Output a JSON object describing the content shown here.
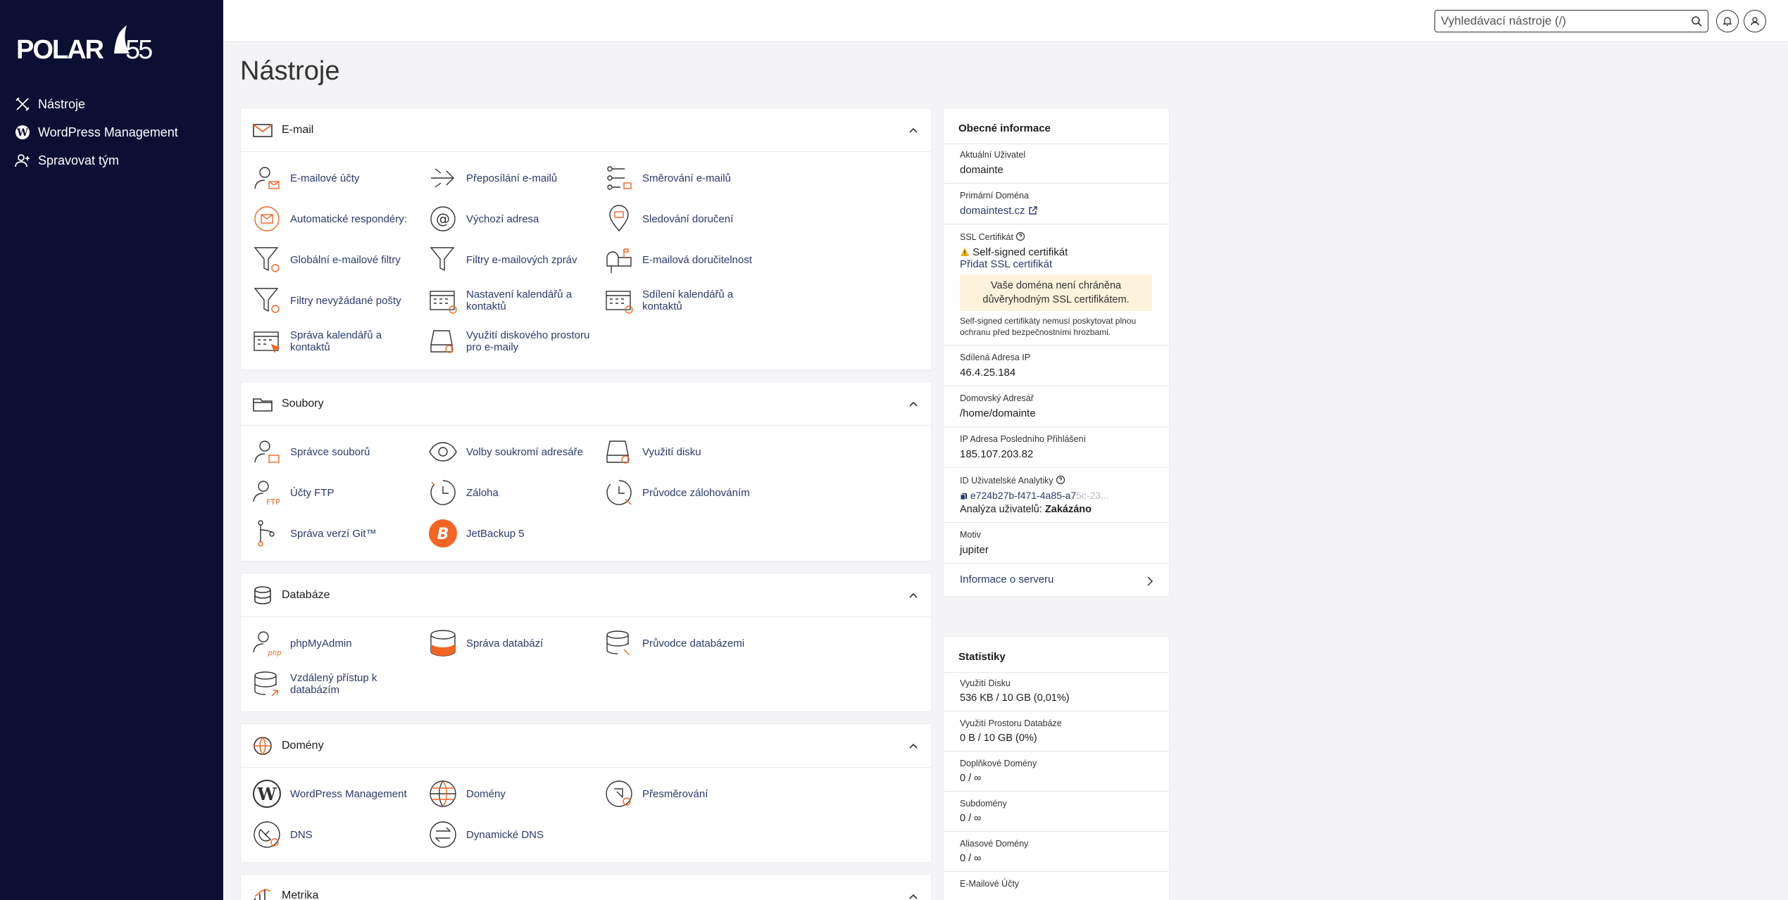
{
  "logo": {
    "text": "POLAR",
    "number": "55"
  },
  "sidebar": {
    "items": [
      {
        "label": "Nástroje",
        "icon": "tools-icon"
      },
      {
        "label": "WordPress Management",
        "icon": "wordpress-icon"
      },
      {
        "label": "Spravovat tým",
        "icon": "user-plus-icon"
      }
    ]
  },
  "topbar": {
    "search_placeholder": "Vyhledávací nástroje (/)"
  },
  "page_title": "Nástroje",
  "sections": [
    {
      "title": "E-mail",
      "items": [
        "E-mailové účty",
        "Přeposílání e-mailů",
        "Směrování e-mailů",
        "Automatické respondéry:",
        "Výchozí adresa",
        "Sledování doručení",
        "Globální e-mailové filtry",
        "Filtry e-mailových zpráv",
        "E-mailová doručitelnost",
        "Filtry nevyžádané pošty",
        "Nastavení kalendářů a kontaktů",
        "Sdílení kalendářů a kontaktů",
        "Správa kalendářů a kontaktů",
        "Využití diskového prostoru pro e-maily"
      ]
    },
    {
      "title": "Soubory",
      "items": [
        "Správce souborů",
        "Volby soukromí adresáře",
        "Využití disku",
        "Účty FTP",
        "Záloha",
        "Průvodce zálohováním",
        "Správa verzí Git™",
        "JetBackup 5"
      ]
    },
    {
      "title": "Databáze",
      "items": [
        "phpMyAdmin",
        "Správa databází",
        "Průvodce databázemi",
        "Vzdálený přístup k databázím"
      ]
    },
    {
      "title": "Domény",
      "items": [
        "WordPress Management",
        "Domény",
        "Přesměrování",
        "DNS",
        "Dynamické DNS"
      ]
    },
    {
      "title": "Metrika",
      "items": []
    }
  ],
  "info": {
    "title": "Obecné informace",
    "current_user_label": "Aktuální Uživatel",
    "current_user": "domainte",
    "primary_domain_label": "Primární Doména",
    "primary_domain": "domaintest.cz",
    "ssl_label": "SSL Certifikát",
    "ssl_status": "Self-signed certifikát",
    "ssl_add": "Přidat SSL certifikát",
    "ssl_warning": "Vaše doména není chráněna důvěryhodným SSL certifikátem.",
    "ssl_note": "Self-signed certifikáty nemusí poskytovat plnou ochranu před bezpečnostními hrozbami.",
    "shared_ip_label": "Sdílená Adresa IP",
    "shared_ip": "46.4.25.184",
    "home_label": "Domovský Adresář",
    "home": "/home/domainte",
    "last_ip_label": "IP Adresa Posledního Přihlášení",
    "last_ip": "185.107.203.82",
    "analytics_label": "ID Uživatelské Analytiky",
    "analytics_id": "e724b27b-f471-4a85-a7",
    "analytics_id_faded": "5c-23...",
    "analytics_state_label": "Analýza uživatelů:",
    "analytics_state": "Zakázáno",
    "theme_label": "Motiv",
    "theme": "jupiter",
    "server_info": "Informace o serveru"
  },
  "stats": {
    "title": "Statistiky",
    "rows": [
      {
        "label": "Využití Disku",
        "value": "536 KB / 10 GB   (0,01%)"
      },
      {
        "label": "Využití Prostoru Databáze",
        "value": "0 B / 10 GB   (0%)"
      },
      {
        "label": "Doplňkové Domény",
        "value": "0 / ∞"
      },
      {
        "label": "Subdomény",
        "value": "0 / ∞"
      },
      {
        "label": "Aliasové Domény",
        "value": "0 / ∞"
      },
      {
        "label": "E-Mailové Účty",
        "value": ""
      }
    ]
  },
  "colors": {
    "sidebar": "#0b0f33",
    "accent": "#f26522",
    "link": "#2a3a6e",
    "warning_bg": "#fdf3dc"
  }
}
